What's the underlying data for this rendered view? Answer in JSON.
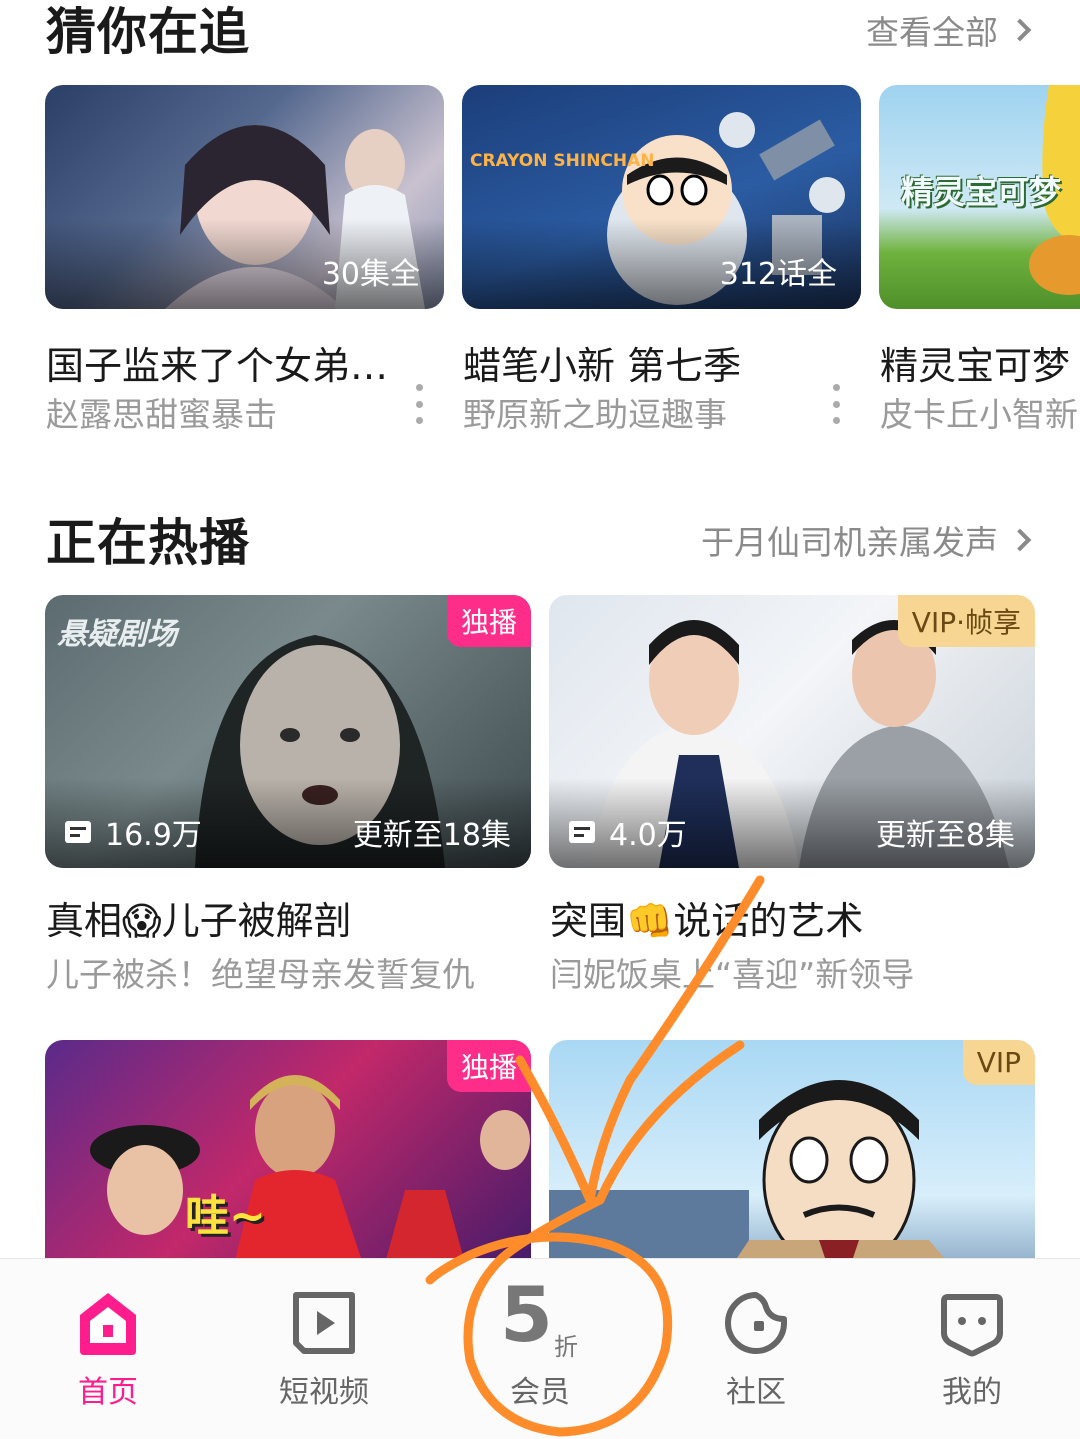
{
  "sections": {
    "watching": {
      "title": "猜你在追",
      "link": "查看全部",
      "cards": [
        {
          "badge_text": "30集全",
          "title": "国子监来了个女弟…",
          "subtitle": "赵露思甜蜜暴击"
        },
        {
          "badge_text": "312话全",
          "title": "蜡笔小新 第七季",
          "subtitle": "野原新之助逗趣事",
          "logo_text": "CRAYON SHINCHAN"
        },
        {
          "title": "精灵宝可梦",
          "subtitle": "皮卡丘小智新",
          "logo_text": "精灵宝可梦"
        }
      ]
    },
    "hot": {
      "title": "正在热播",
      "link": "于月仙司机亲属发声",
      "cards": [
        {
          "tag": "独播",
          "views": "16.9万",
          "update": "更新至18集",
          "title": "真相😱儿子被解剖",
          "subtitle": "儿子被杀！绝望母亲发誓复仇",
          "watermark": "悬疑剧场"
        },
        {
          "tag": "VIP·帧享",
          "views": "4.0万",
          "update": "更新至8集",
          "title": "突围👊说话的艺术",
          "subtitle": "闫妮饭桌上“喜迎”新领导"
        },
        {
          "tag": "独播",
          "caption": "哇~"
        },
        {
          "tag": "VIP"
        }
      ]
    }
  },
  "tabbar": {
    "tabs": [
      {
        "label": "首页",
        "icon": "home-icon",
        "active": true
      },
      {
        "label": "短视频",
        "icon": "play-icon",
        "active": false
      },
      {
        "label": "会员",
        "icon": "discount-5-icon",
        "discount_number": "5",
        "discount_unit": "折",
        "active": false
      },
      {
        "label": "社区",
        "icon": "community-icon",
        "active": false
      },
      {
        "label": "我的",
        "icon": "profile-icon",
        "active": false
      }
    ]
  },
  "colors": {
    "accent": "#ff1d8e",
    "annotation": "#ff8c2a",
    "vip_badge": "#f6d692",
    "exclusive_badge": "#ff2d8a"
  }
}
